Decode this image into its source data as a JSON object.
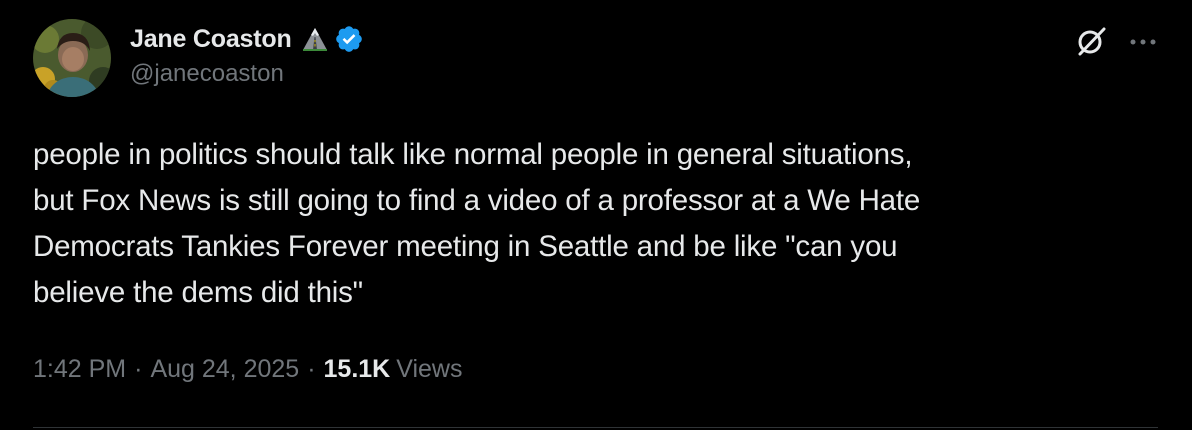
{
  "author": {
    "display_name": "Jane Coaston",
    "handle": "@janecoaston",
    "name_emoji": "mountain-road-emoji",
    "verified_badge": "verified-check-icon",
    "verified_color": "#1d9bf0"
  },
  "tweet": {
    "text": "people in politics should talk like normal people in general situations,\nbut Fox News is still going to find a video of a professor at a We Hate\nDemocrats Tankies Forever meeting in Seattle and be like \"can you\nbelieve the dems did this\""
  },
  "meta": {
    "time": "1:42 PM",
    "separator": "·",
    "date": "Aug 24, 2025",
    "views_count": "15.1K",
    "views_label": "Views"
  },
  "actions": {
    "grok_icon": "grok-icon",
    "more_icon": "more-options-icon"
  },
  "colors": {
    "background": "#000000",
    "primary_text": "#e7e9ea",
    "secondary_text": "#71767b",
    "divider": "#2f3336"
  }
}
